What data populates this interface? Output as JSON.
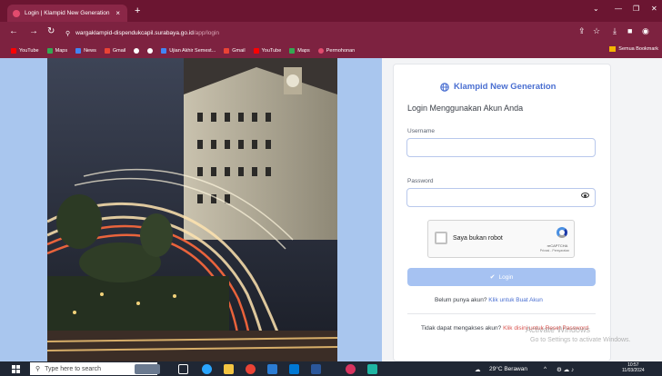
{
  "browser": {
    "tab_title": "Login | Klampid New Generation",
    "tab_close": "×",
    "new_tab": "+",
    "url_host": "wargaklampid-dispendukcapil.surabaya.go.id",
    "url_path": "/app/login",
    "bookmarks": [
      {
        "label": "YouTube",
        "color": "#ff0000"
      },
      {
        "label": "Maps",
        "color": "#34a853"
      },
      {
        "label": "News",
        "color": "#4285f4"
      },
      {
        "label": "Gmail",
        "color": "#ea4335"
      },
      {
        "label": "",
        "color": "#ffffff"
      },
      {
        "label": "",
        "color": "#ffffff"
      },
      {
        "label": "Ujian Akhir Semest...",
        "color": "#4285f4"
      },
      {
        "label": "Gmail",
        "color": "#ea4335"
      },
      {
        "label": "YouTube",
        "color": "#ff0000"
      },
      {
        "label": "Maps",
        "color": "#34a853"
      },
      {
        "label": "Permohonan",
        "color": "#e24b6e"
      }
    ],
    "all_bookmarks": "Semua Bookmark"
  },
  "login": {
    "brand": "Klampid New Generation",
    "subtitle": "Login Menggunakan Akun Anda",
    "username_label": "Username",
    "username_value": "",
    "password_label": "Password",
    "password_value": "",
    "captcha_text": "Saya bukan robot",
    "captcha_brand": "reCAPTCHA",
    "captcha_terms": "Privasi - Persyaratan",
    "login_button": "Login",
    "register_prompt": "Belum punya akun?",
    "register_link": "Klik untuk Buat Akun",
    "reset_prompt": "Tidak dapat mengakses akun?",
    "reset_link": "Klik disini untuk Reset Password"
  },
  "watermark": {
    "line1": "Activate Windows",
    "line2": "Go to Settings to activate Windows."
  },
  "taskbar": {
    "search_placeholder": "Type here to search",
    "weather": "29°C Berawan",
    "time": "10:57",
    "date": "11/03/2024"
  },
  "colors": {
    "brand_blue": "#4a6fd1",
    "chrome_maroon": "#7a1f3a",
    "reset_red": "#d9534f"
  }
}
